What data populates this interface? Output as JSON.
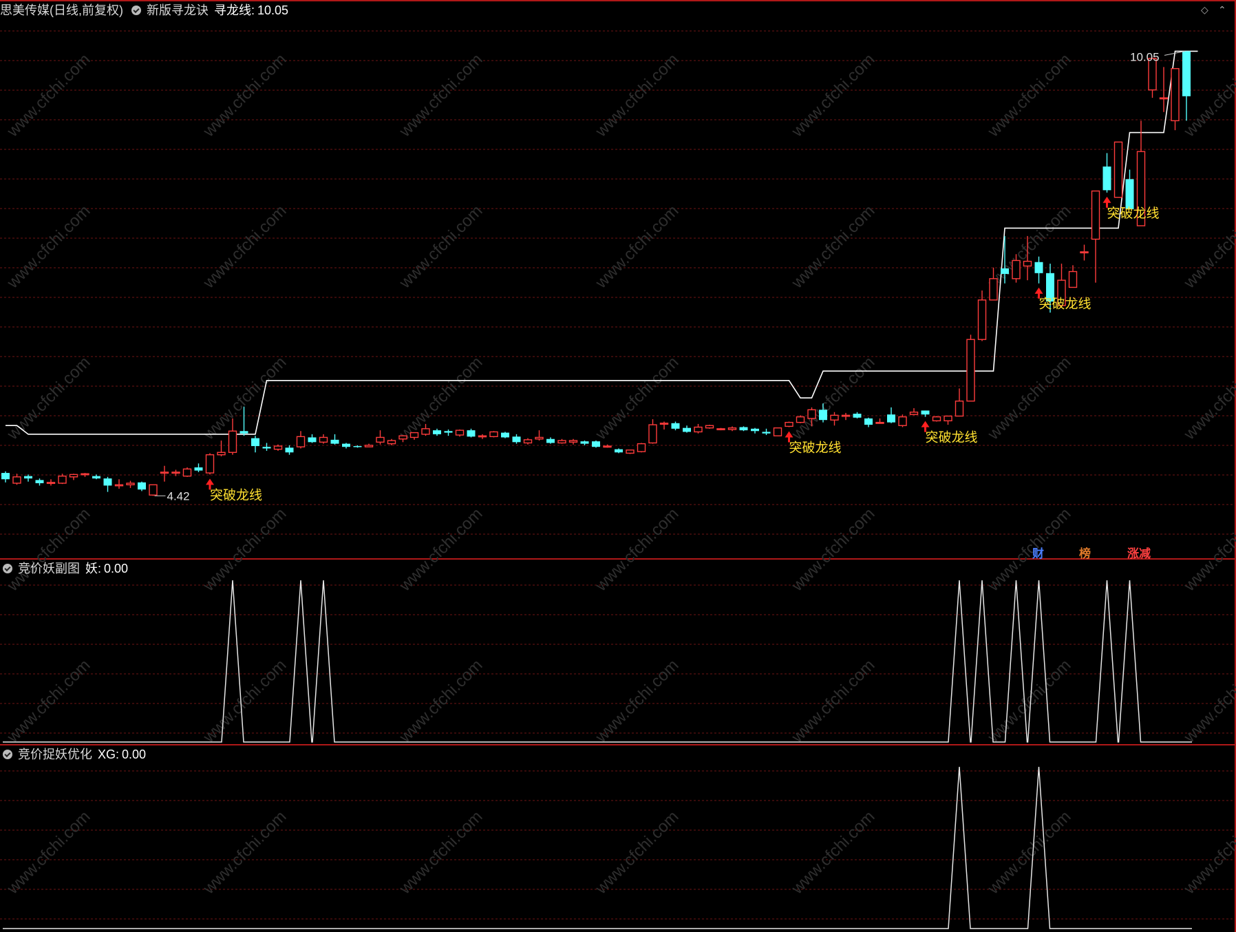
{
  "main_panel": {
    "stock_name": "思美传媒",
    "period": "(日线,前复权)",
    "indicator_name": "新版寻龙诀",
    "line_label": "寻龙线:",
    "line_value": "10.05"
  },
  "badges": [
    {
      "text": "财",
      "color": "#4a7fff"
    },
    {
      "text": "榜",
      "color": "#e07a2a"
    },
    {
      "text": "涨减",
      "color": "#ff4040"
    }
  ],
  "sub1": {
    "name": "竞价妖副图",
    "label": "妖:",
    "value": "0.00"
  },
  "sub2": {
    "name": "竞价捉妖优化",
    "label": "XG:",
    "value": "0.00"
  },
  "watermark": "www.cfchi.com",
  "colors": {
    "up": "#ff3c3c",
    "down": "#54ffff",
    "line": "#ffffff",
    "signal": "#ffe030",
    "arrow": "#ff2020",
    "grid": "#5a1010",
    "separator": "#b01818"
  },
  "chart_data": {
    "type": "candlestick",
    "y_range": [
      3.9,
      10.35
    ],
    "high_label": "10.05",
    "low_label": "4.42",
    "signal_text": "突破龙线",
    "candles": [
      {
        "o": 4.71,
        "h": 4.73,
        "l": 4.59,
        "c": 4.63
      },
      {
        "o": 4.58,
        "h": 4.7,
        "l": 4.56,
        "c": 4.66
      },
      {
        "o": 4.67,
        "h": 4.69,
        "l": 4.6,
        "c": 4.64
      },
      {
        "o": 4.62,
        "h": 4.64,
        "l": 4.55,
        "c": 4.58
      },
      {
        "o": 4.58,
        "h": 4.63,
        "l": 4.55,
        "c": 4.59
      },
      {
        "o": 4.58,
        "h": 4.7,
        "l": 4.57,
        "c": 4.67
      },
      {
        "o": 4.66,
        "h": 4.7,
        "l": 4.62,
        "c": 4.69
      },
      {
        "o": 4.69,
        "h": 4.71,
        "l": 4.66,
        "c": 4.7
      },
      {
        "o": 4.67,
        "h": 4.69,
        "l": 4.63,
        "c": 4.64
      },
      {
        "o": 4.64,
        "h": 4.66,
        "l": 4.47,
        "c": 4.55
      },
      {
        "o": 4.56,
        "h": 4.63,
        "l": 4.51,
        "c": 4.56
      },
      {
        "o": 4.56,
        "h": 4.61,
        "l": 4.52,
        "c": 4.58
      },
      {
        "o": 4.59,
        "h": 4.6,
        "l": 4.48,
        "c": 4.5
      },
      {
        "o": 4.43,
        "h": 4.56,
        "l": 4.42,
        "c": 4.56
      },
      {
        "o": 4.72,
        "h": 4.8,
        "l": 4.6,
        "c": 4.72
      },
      {
        "o": 4.72,
        "h": 4.75,
        "l": 4.67,
        "c": 4.72
      },
      {
        "o": 4.67,
        "h": 4.78,
        "l": 4.66,
        "c": 4.76
      },
      {
        "o": 4.78,
        "h": 4.83,
        "l": 4.72,
        "c": 4.74
      },
      {
        "o": 4.71,
        "h": 4.96,
        "l": 4.69,
        "c": 4.94
      },
      {
        "o": 4.94,
        "h": 5.12,
        "l": 4.92,
        "c": 4.97
      },
      {
        "o": 4.97,
        "h": 5.4,
        "l": 4.94,
        "c": 5.24
      },
      {
        "o": 5.24,
        "h": 5.55,
        "l": 5.18,
        "c": 5.21
      },
      {
        "o": 5.15,
        "h": 5.18,
        "l": 4.97,
        "c": 5.05
      },
      {
        "o": 5.04,
        "h": 5.09,
        "l": 4.99,
        "c": 5.02
      },
      {
        "o": 5.01,
        "h": 5.07,
        "l": 4.99,
        "c": 5.05
      },
      {
        "o": 5.03,
        "h": 5.06,
        "l": 4.94,
        "c": 4.97
      },
      {
        "o": 5.04,
        "h": 5.24,
        "l": 5.02,
        "c": 5.17
      },
      {
        "o": 5.16,
        "h": 5.2,
        "l": 5.09,
        "c": 5.1
      },
      {
        "o": 5.1,
        "h": 5.2,
        "l": 5.08,
        "c": 5.16
      },
      {
        "o": 5.13,
        "h": 5.2,
        "l": 5.07,
        "c": 5.08
      },
      {
        "o": 5.08,
        "h": 5.09,
        "l": 5.02,
        "c": 5.04
      },
      {
        "o": 5.05,
        "h": 5.06,
        "l": 5.03,
        "c": 5.04
      },
      {
        "o": 5.04,
        "h": 5.08,
        "l": 5.04,
        "c": 5.06
      },
      {
        "o": 5.1,
        "h": 5.25,
        "l": 5.07,
        "c": 5.16
      },
      {
        "o": 5.08,
        "h": 5.14,
        "l": 5.06,
        "c": 5.12
      },
      {
        "o": 5.14,
        "h": 5.18,
        "l": 5.1,
        "c": 5.18
      },
      {
        "o": 5.16,
        "h": 5.22,
        "l": 5.13,
        "c": 5.22
      },
      {
        "o": 5.2,
        "h": 5.33,
        "l": 5.18,
        "c": 5.27
      },
      {
        "o": 5.25,
        "h": 5.27,
        "l": 5.18,
        "c": 5.2
      },
      {
        "o": 5.24,
        "h": 5.26,
        "l": 5.18,
        "c": 5.22
      },
      {
        "o": 5.19,
        "h": 5.26,
        "l": 5.17,
        "c": 5.25
      },
      {
        "o": 5.25,
        "h": 5.27,
        "l": 5.16,
        "c": 5.17
      },
      {
        "o": 5.17,
        "h": 5.2,
        "l": 5.14,
        "c": 5.18
      },
      {
        "o": 5.17,
        "h": 5.24,
        "l": 5.16,
        "c": 5.23
      },
      {
        "o": 5.22,
        "h": 5.23,
        "l": 5.15,
        "c": 5.16
      },
      {
        "o": 5.17,
        "h": 5.2,
        "l": 5.08,
        "c": 5.1
      },
      {
        "o": 5.09,
        "h": 5.15,
        "l": 5.07,
        "c": 5.13
      },
      {
        "o": 5.14,
        "h": 5.25,
        "l": 5.12,
        "c": 5.16
      },
      {
        "o": 5.14,
        "h": 5.16,
        "l": 5.08,
        "c": 5.09
      },
      {
        "o": 5.09,
        "h": 5.14,
        "l": 5.08,
        "c": 5.12
      },
      {
        "o": 5.1,
        "h": 5.14,
        "l": 5.07,
        "c": 5.12
      },
      {
        "o": 5.11,
        "h": 5.12,
        "l": 5.06,
        "c": 5.08
      },
      {
        "o": 5.11,
        "h": 5.12,
        "l": 5.03,
        "c": 5.04
      },
      {
        "o": 5.05,
        "h": 5.07,
        "l": 5.03,
        "c": 5.05
      },
      {
        "o": 5.01,
        "h": 5.02,
        "l": 4.96,
        "c": 4.97
      },
      {
        "o": 4.96,
        "h": 5.0,
        "l": 4.95,
        "c": 5.0
      },
      {
        "o": 4.98,
        "h": 5.09,
        "l": 4.97,
        "c": 5.08
      },
      {
        "o": 5.09,
        "h": 5.39,
        "l": 5.08,
        "c": 5.32
      },
      {
        "o": 5.34,
        "h": 5.36,
        "l": 5.26,
        "c": 5.34
      },
      {
        "o": 5.34,
        "h": 5.36,
        "l": 5.25,
        "c": 5.27
      },
      {
        "o": 5.28,
        "h": 5.31,
        "l": 5.22,
        "c": 5.23
      },
      {
        "o": 5.23,
        "h": 5.33,
        "l": 5.21,
        "c": 5.29
      },
      {
        "o": 5.28,
        "h": 5.32,
        "l": 5.27,
        "c": 5.31
      },
      {
        "o": 5.27,
        "h": 5.28,
        "l": 5.25,
        "c": 5.27
      },
      {
        "o": 5.26,
        "h": 5.3,
        "l": 5.24,
        "c": 5.28
      },
      {
        "o": 5.29,
        "h": 5.3,
        "l": 5.24,
        "c": 5.25
      },
      {
        "o": 5.27,
        "h": 5.28,
        "l": 5.21,
        "c": 5.24
      },
      {
        "o": 5.23,
        "h": 5.27,
        "l": 5.19,
        "c": 5.21
      },
      {
        "o": 5.18,
        "h": 5.28,
        "l": 5.18,
        "c": 5.28
      },
      {
        "o": 5.3,
        "h": 5.36,
        "l": 5.29,
        "c": 5.35
      },
      {
        "o": 5.35,
        "h": 5.44,
        "l": 5.34,
        "c": 5.42
      },
      {
        "o": 5.4,
        "h": 5.54,
        "l": 5.3,
        "c": 5.51
      },
      {
        "o": 5.51,
        "h": 5.59,
        "l": 5.35,
        "c": 5.38
      },
      {
        "o": 5.38,
        "h": 5.48,
        "l": 5.31,
        "c": 5.44
      },
      {
        "o": 5.44,
        "h": 5.47,
        "l": 5.38,
        "c": 5.44
      },
      {
        "o": 5.46,
        "h": 5.48,
        "l": 5.4,
        "c": 5.41
      },
      {
        "o": 5.4,
        "h": 5.41,
        "l": 5.29,
        "c": 5.32
      },
      {
        "o": 5.35,
        "h": 5.4,
        "l": 5.34,
        "c": 5.35
      },
      {
        "o": 5.45,
        "h": 5.54,
        "l": 5.34,
        "c": 5.35
      },
      {
        "o": 5.31,
        "h": 5.45,
        "l": 5.29,
        "c": 5.42
      },
      {
        "o": 5.45,
        "h": 5.53,
        "l": 5.44,
        "c": 5.48
      },
      {
        "o": 5.5,
        "h": 5.5,
        "l": 5.42,
        "c": 5.45
      },
      {
        "o": 5.37,
        "h": 5.43,
        "l": 5.36,
        "c": 5.42
      },
      {
        "o": 5.37,
        "h": 5.43,
        "l": 5.32,
        "c": 5.43
      },
      {
        "o": 5.43,
        "h": 5.78,
        "l": 5.43,
        "c": 5.62
      },
      {
        "o": 5.62,
        "h": 6.46,
        "l": 5.62,
        "c": 6.4
      },
      {
        "o": 6.4,
        "h": 7.02,
        "l": 6.38,
        "c": 6.9
      },
      {
        "o": 6.9,
        "h": 7.31,
        "l": 6.9,
        "c": 7.17
      },
      {
        "o": 7.3,
        "h": 7.71,
        "l": 7.11,
        "c": 7.23
      },
      {
        "o": 7.17,
        "h": 7.48,
        "l": 7.12,
        "c": 7.4
      },
      {
        "o": 7.33,
        "h": 7.71,
        "l": 7.15,
        "c": 7.39
      },
      {
        "o": 7.38,
        "h": 7.45,
        "l": 7.11,
        "c": 7.24
      },
      {
        "o": 7.24,
        "h": 7.36,
        "l": 6.74,
        "c": 6.88
      },
      {
        "o": 6.83,
        "h": 7.36,
        "l": 6.81,
        "c": 7.15
      },
      {
        "o": 7.06,
        "h": 7.34,
        "l": 7.06,
        "c": 7.26
      },
      {
        "o": 7.51,
        "h": 7.6,
        "l": 7.4,
        "c": 7.51
      },
      {
        "o": 7.67,
        "h": 8.28,
        "l": 7.12,
        "c": 8.28
      },
      {
        "o": 8.59,
        "h": 8.76,
        "l": 8.26,
        "c": 8.29
      },
      {
        "o": 8.2,
        "h": 8.85,
        "l": 8.2,
        "c": 8.9
      },
      {
        "o": 8.43,
        "h": 8.55,
        "l": 8.05,
        "c": 8.05
      },
      {
        "o": 7.84,
        "h": 9.17,
        "l": 7.84,
        "c": 8.78
      },
      {
        "o": 9.56,
        "h": 9.8,
        "l": 9.46,
        "c": 9.96
      },
      {
        "o": 9.45,
        "h": 9.85,
        "l": 9.28,
        "c": 9.46
      },
      {
        "o": 9.17,
        "h": 9.8,
        "l": 9.05,
        "c": 9.83
      },
      {
        "o": 10.05,
        "h": 10.05,
        "l": 9.17,
        "c": 9.48
      }
    ],
    "dragon_line_points": [
      [
        0,
        5.31
      ],
      [
        1,
        5.31
      ],
      [
        2,
        5.2
      ],
      [
        3,
        5.2
      ],
      [
        21,
        5.2
      ],
      [
        22,
        5.2
      ],
      [
        23,
        5.88
      ],
      [
        68,
        5.88
      ],
      [
        69,
        5.88
      ],
      [
        70,
        5.66
      ],
      [
        71,
        5.66
      ],
      [
        72,
        6.0
      ],
      [
        86,
        6.0
      ],
      [
        87,
        6.0
      ],
      [
        88,
        7.81
      ],
      [
        97,
        7.81
      ],
      [
        98,
        7.81
      ],
      [
        99,
        9.02
      ],
      [
        101,
        9.02
      ],
      [
        102,
        9.02
      ],
      [
        103,
        10.05
      ],
      [
        105,
        10.05
      ]
    ],
    "breakout_signals": [
      18,
      69,
      81,
      91,
      97
    ],
    "sub1_peaks": [
      20,
      26,
      28,
      84,
      86,
      89,
      91,
      97,
      99
    ],
    "sub2_peaks": [
      84,
      91
    ]
  }
}
